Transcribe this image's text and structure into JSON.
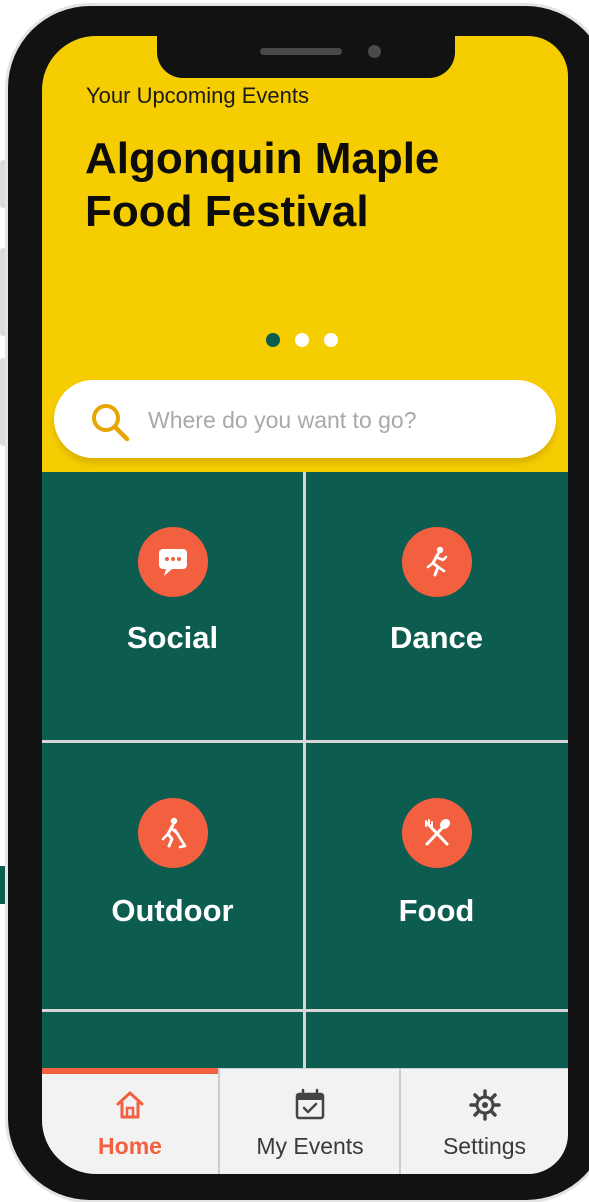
{
  "hero": {
    "subtitle": "Your Upcoming Events",
    "title": "Algonquin Maple Food Festival",
    "carousel_pages": 3,
    "active_page": 1
  },
  "search": {
    "placeholder": "Where do you want to go?",
    "value": ""
  },
  "categories": [
    {
      "label": "Social",
      "icon": "chat-bubble-icon"
    },
    {
      "label": "Dance",
      "icon": "running-person-icon"
    },
    {
      "label": "Outdoor",
      "icon": "hockey-player-icon"
    },
    {
      "label": "Food",
      "icon": "fork-spoon-icon"
    }
  ],
  "tabs": [
    {
      "label": "Home",
      "icon": "home-icon",
      "active": true
    },
    {
      "label": "My Events",
      "icon": "calendar-check-icon",
      "active": false
    },
    {
      "label": "Settings",
      "icon": "gear-icon",
      "active": false
    }
  ],
  "colors": {
    "hero_yellow": "#f6cd00",
    "grid_green": "#0d5c50",
    "accent_orange": "#f26040",
    "search_icon": "#e8a500"
  }
}
